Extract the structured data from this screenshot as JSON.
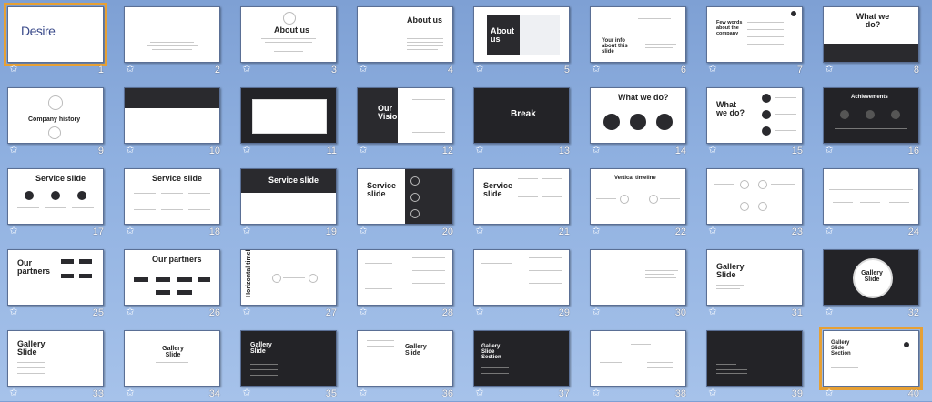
{
  "slides": [
    {
      "number": "1",
      "title": "Desire"
    },
    {
      "number": "2",
      "title": ""
    },
    {
      "number": "3",
      "title": "About us"
    },
    {
      "number": "4",
      "title": "About us"
    },
    {
      "number": "5",
      "title": "About us"
    },
    {
      "number": "6",
      "title": "Your info about this slide"
    },
    {
      "number": "7",
      "title": "Few words about the company"
    },
    {
      "number": "8",
      "title": "What we do?"
    },
    {
      "number": "9",
      "title": "Company history"
    },
    {
      "number": "10",
      "title": ""
    },
    {
      "number": "11",
      "title": ""
    },
    {
      "number": "12",
      "title": "Our Vision"
    },
    {
      "number": "13",
      "title": "Break"
    },
    {
      "number": "14",
      "title": "What we do?"
    },
    {
      "number": "15",
      "title": "What we do?"
    },
    {
      "number": "16",
      "title": "Achievements"
    },
    {
      "number": "17",
      "title": "Service slide"
    },
    {
      "number": "18",
      "title": "Service slide"
    },
    {
      "number": "19",
      "title": "Service slide"
    },
    {
      "number": "20",
      "title": "Service slide"
    },
    {
      "number": "21",
      "title": "Service slide"
    },
    {
      "number": "22",
      "title": "Vertical timeline"
    },
    {
      "number": "23",
      "title": ""
    },
    {
      "number": "24",
      "title": ""
    },
    {
      "number": "25",
      "title": "Our partners"
    },
    {
      "number": "26",
      "title": "Our partners"
    },
    {
      "number": "27",
      "title": "Horizontal timeline"
    },
    {
      "number": "28",
      "title": ""
    },
    {
      "number": "29",
      "title": ""
    },
    {
      "number": "30",
      "title": ""
    },
    {
      "number": "31",
      "title": "Gallery Slide"
    },
    {
      "number": "32",
      "title": "Gallery Slide"
    },
    {
      "number": "33",
      "title": "Gallery Slide"
    },
    {
      "number": "34",
      "title": "Gallery Slide"
    },
    {
      "number": "35",
      "title": "Gallery Slide"
    },
    {
      "number": "36",
      "title": "Gallery Slide"
    },
    {
      "number": "37",
      "title": "Gallery Slide Section"
    },
    {
      "number": "38",
      "title": ""
    },
    {
      "number": "39",
      "title": ""
    },
    {
      "number": "40",
      "title": "Gallery Slide Section"
    }
  ],
  "colors": {
    "background": "#8fb0e0",
    "selection": "#e6a035",
    "dark_slide": "#232327"
  },
  "icons": {
    "transition": "slide-transition-star-icon"
  }
}
